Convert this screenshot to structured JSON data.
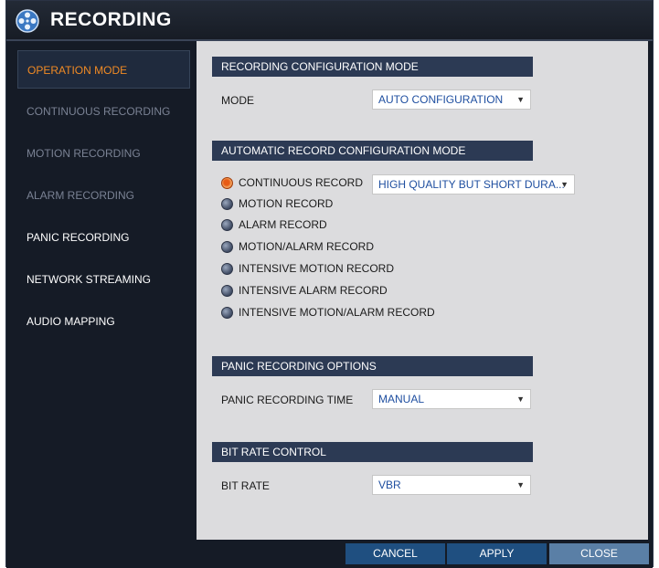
{
  "window": {
    "title": "RECORDING",
    "icon": "film-reel-icon"
  },
  "sidebar": {
    "items": [
      {
        "label": "OPERATION MODE"
      },
      {
        "label": "CONTINUOUS RECORDING"
      },
      {
        "label": "MOTION RECORDING"
      },
      {
        "label": "ALARM RECORDING"
      },
      {
        "label": "PANIC RECORDING"
      },
      {
        "label": "NETWORK STREAMING"
      },
      {
        "label": "AUDIO MAPPING"
      }
    ]
  },
  "config_mode": {
    "header": "RECORDING CONFIGURATION MODE",
    "mode_label": "MODE",
    "mode_value": "AUTO CONFIGURATION"
  },
  "auto_mode": {
    "header": "AUTOMATIC RECORD CONFIGURATION MODE",
    "options": [
      {
        "label": "CONTINUOUS RECORD",
        "selected": true
      },
      {
        "label": "MOTION RECORD",
        "selected": false
      },
      {
        "label": "ALARM RECORD",
        "selected": false
      },
      {
        "label": "MOTION/ALARM RECORD",
        "selected": false
      },
      {
        "label": "INTENSIVE MOTION RECORD",
        "selected": false
      },
      {
        "label": "INTENSIVE ALARM RECORD",
        "selected": false
      },
      {
        "label": "INTENSIVE MOTION/ALARM RECORD",
        "selected": false
      }
    ],
    "quality_value": "HIGH QUALITY BUT SHORT DURA..."
  },
  "panic": {
    "header": "PANIC RECORDING OPTIONS",
    "time_label": "PANIC RECORDING TIME",
    "time_value": "MANUAL"
  },
  "bitrate": {
    "header": "BIT RATE CONTROL",
    "label": "BIT RATE",
    "value": "VBR"
  },
  "buttons": {
    "cancel": "CANCEL",
    "apply": "APPLY",
    "close": "CLOSE"
  },
  "colors": {
    "accent": "#f08a24",
    "header_bg": "#2c3a54",
    "panel_bg": "#dcdcde",
    "button_blue": "#1f4f80"
  }
}
